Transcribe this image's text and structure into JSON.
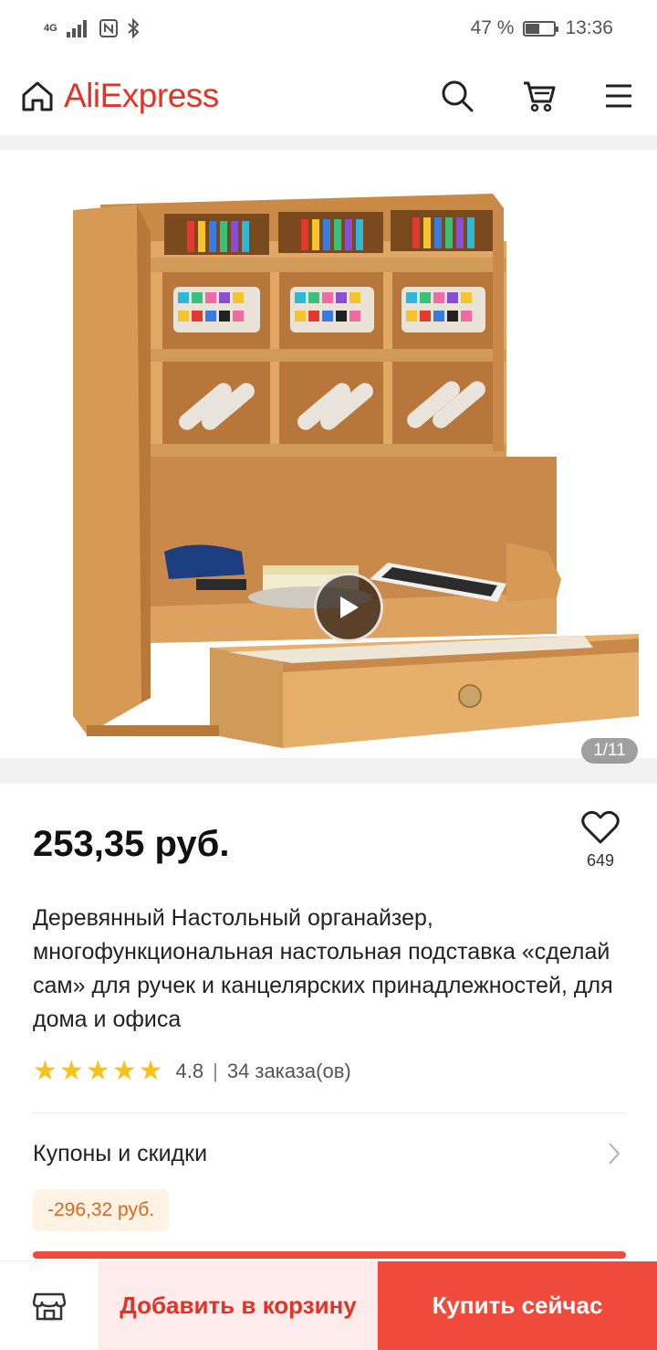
{
  "status_bar": {
    "network": "4G",
    "battery_percent": "47 %",
    "battery_level": 0.47,
    "time": "13:36",
    "icons": [
      "signal-icon",
      "nfc-icon",
      "bluetooth-icon",
      "battery-icon"
    ]
  },
  "header": {
    "logo": "AliExpress",
    "icons": [
      "home-icon",
      "search-icon",
      "cart-icon",
      "menu-icon"
    ]
  },
  "gallery": {
    "counter": "1/11",
    "play_icon": "play-icon"
  },
  "product": {
    "price": "253,35 руб.",
    "wishlist_count": "649",
    "title": "Деревянный Настольный органайзер, многофункциональная настольная подставка «сделай сам» для ручек и канцелярских принадлежностей, для дома и офиса",
    "rating": "4.8",
    "rating_stars": 5,
    "separator": "|",
    "orders": "34 заказа(ов)"
  },
  "coupons": {
    "label": "Купоны и скидки",
    "discount": "-296,32 руб."
  },
  "bottom_bar": {
    "store_icon": "store-icon",
    "add_to_cart": "Добавить в корзину",
    "buy_now": "Купить сейчас"
  },
  "colors": {
    "brand": "#e43225",
    "buy_button": "#f04a3c",
    "add_cart_bg": "#fdeceb",
    "star": "#f7c31a",
    "discount_text": "#e0661a",
    "discount_bg": "#fff3e6"
  }
}
